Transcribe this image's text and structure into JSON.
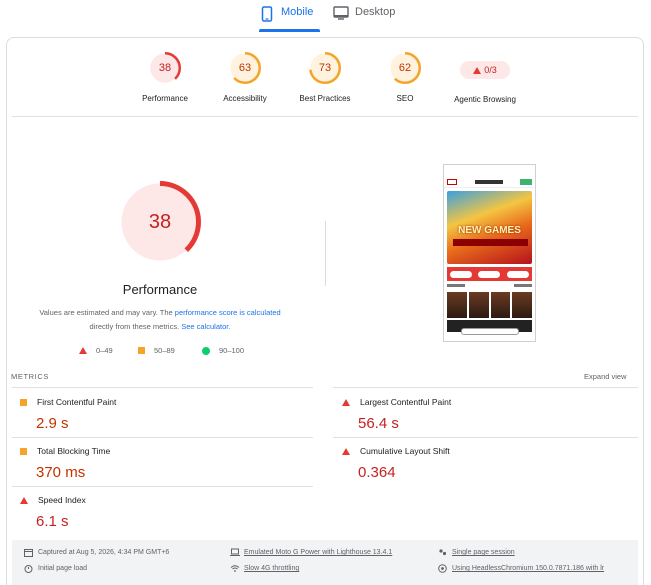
{
  "tabs": {
    "mobile": "Mobile",
    "desktop": "Desktop"
  },
  "scores": [
    {
      "label": "Performance",
      "value": "38",
      "fraction": 0.38,
      "color": "#e53935",
      "text_color": "#c5221f",
      "bg": "#fde7e7"
    },
    {
      "label": "Accessibility",
      "value": "63",
      "fraction": 0.63,
      "color": "#f4a429",
      "text_color": "#c33300",
      "bg": "#fff3e0"
    },
    {
      "label": "Best Practices",
      "value": "73",
      "fraction": 0.73,
      "color": "#f4a429",
      "text_color": "#c33300",
      "bg": "#fff3e0"
    },
    {
      "label": "SEO",
      "value": "62",
      "fraction": 0.62,
      "color": "#f4a429",
      "text_color": "#c33300",
      "bg": "#fff3e0"
    }
  ],
  "agentic": {
    "label": "Agentic Browsing",
    "value": "0/3"
  },
  "performance": {
    "score": "38",
    "fraction": 0.38,
    "title": "Performance",
    "note_prefix": "Values are estimated and may vary. The ",
    "note_link1": "performance score is calculated",
    "note_middle": " directly from these metrics. ",
    "note_link2": "See calculator.",
    "legend": {
      "poor": "0–49",
      "average": "50–89",
      "good": "90–100"
    }
  },
  "thumbnail": {
    "hero_text": "NEW GAMES"
  },
  "metrics": {
    "heading": "METRICS",
    "expand": "Expand view",
    "items": [
      {
        "name": "First Contentful Paint",
        "value": "2.9 s",
        "rating": "average"
      },
      {
        "name": "Largest Contentful Paint",
        "value": "56.4 s",
        "rating": "poor"
      },
      {
        "name": "Total Blocking Time",
        "value": "370 ms",
        "rating": "average"
      },
      {
        "name": "Cumulative Layout Shift",
        "value": "0.364",
        "rating": "poor"
      },
      {
        "name": "Speed Index",
        "value": "6.1 s",
        "rating": "poor"
      }
    ]
  },
  "footer": {
    "captured": "Captured at Aug 5, 2026, 4:34 PM GMT+6",
    "device": "Emulated Moto G Power with Lighthouse 13.4.1",
    "session": "Single page session",
    "load": "Initial page load",
    "throttling": "Slow 4G throttling",
    "browser": "Using HeadlessChromium 150.0.7871.186 with lr"
  }
}
